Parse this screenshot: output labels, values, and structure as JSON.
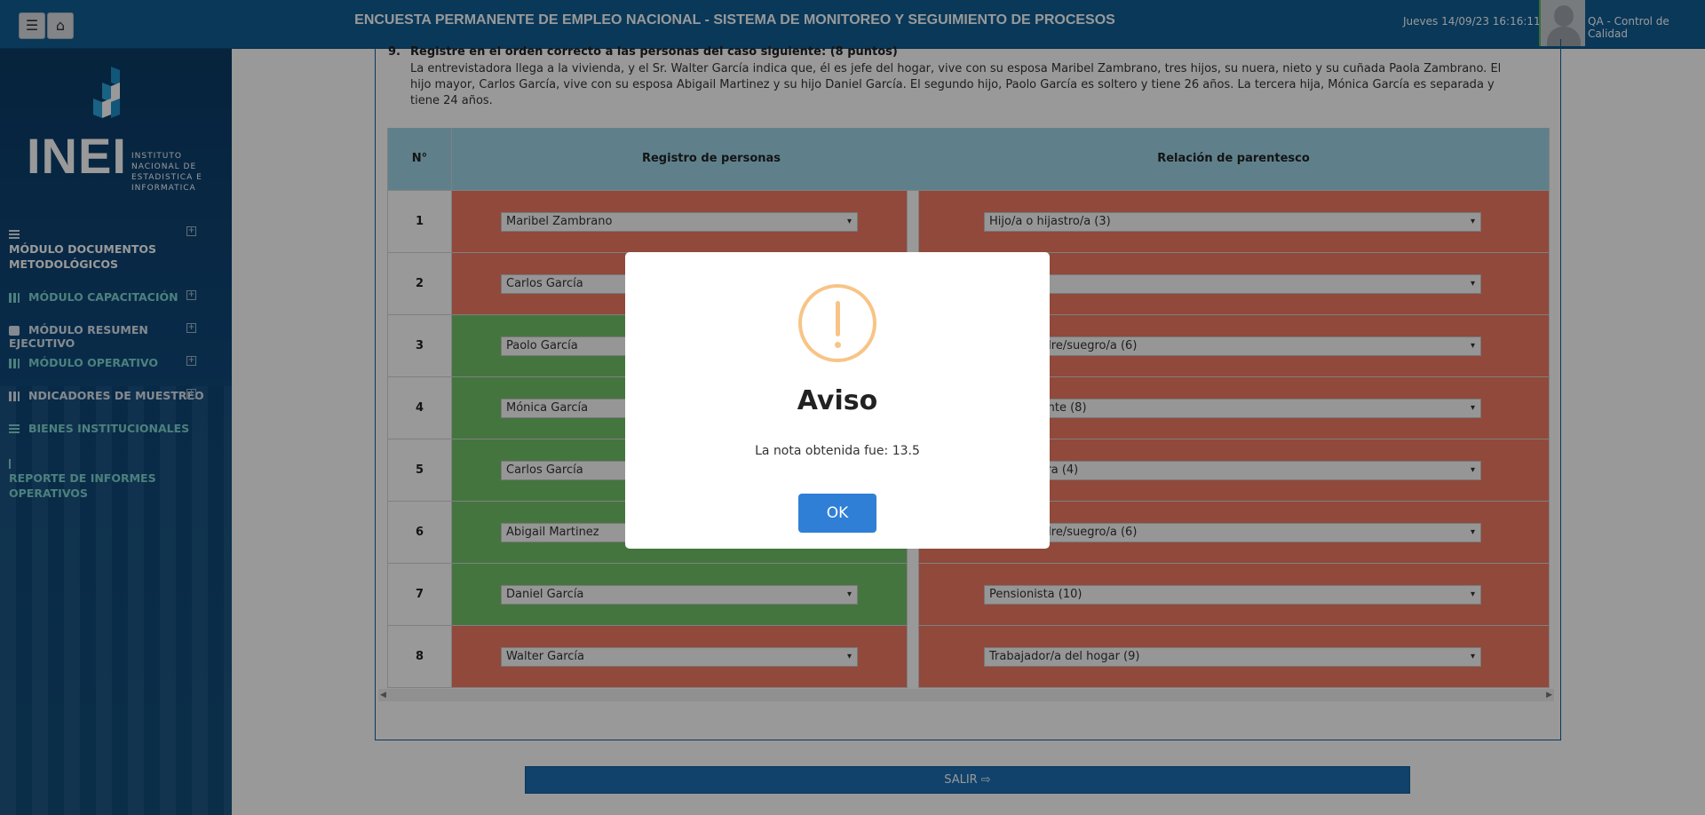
{
  "header": {
    "title": "ENCUESTA PERMANENTE DE EMPLEO NACIONAL - SISTEMA DE MONITOREO Y SEGUIMIENTO DE PROCESOS",
    "datetime": "Jueves 14/09/23 16:16:11",
    "user": "QA - Control de Calidad",
    "menu_icon": "hamburger-icon",
    "home_icon": "home-icon"
  },
  "logo": {
    "name": "INEI",
    "subtitle_lines": [
      "INSTITUTO",
      "NACIONAL DE",
      "ESTADISTICA E",
      "INFORMATICA"
    ]
  },
  "sidebar": {
    "items": [
      {
        "label": "MÓDULO DOCUMENTOS METODOLÓGICOS",
        "icon": "database-icon",
        "color": "#ffffff"
      },
      {
        "label": "MÓDULO CAPACITACIÓN",
        "icon": "bar-chart-icon",
        "color": "#7fd6d0"
      },
      {
        "label": "MÓDULO RESUMEN EJECUTIVO",
        "icon": "briefcase-icon",
        "color": "#dce6ef"
      },
      {
        "label": "MÓDULO OPERATIVO",
        "icon": "bar-chart-icon",
        "color": "#7fd6d0"
      },
      {
        "label": "NDICADORES DE MUESTREO",
        "icon": "bar-chart-icon",
        "color": "#dce6ef"
      },
      {
        "label": "BIENES INSTITUCIONALES",
        "icon": "table-icon",
        "color": "#7fd6d0"
      },
      {
        "label": "REPORTE DE INFORMES OPERATIVOS",
        "icon": "flag-icon",
        "color": "#7fd6d0"
      }
    ]
  },
  "question": {
    "number": "9.",
    "heading": "Registre en el orden correcto a las personas del caso siguiente: (8 puntos)",
    "text": "La entrevistadora llega a la vivienda, y el Sr. Walter García indica que, él es jefe del hogar, vive con su esposa Maribel Zambrano, tres hijos, su nuera, nieto y su cuñada Paola Zambrano. El hijo mayor, Carlos García, vive con su esposa Abigail Martinez y su hijo Daniel García. El segundo hijo, Paolo García es soltero y tiene 26 años. La tercera hija, Mónica García es separada y tiene 24 años."
  },
  "table": {
    "headers": [
      "N°",
      "Registro de personas",
      "Relación de parentesco"
    ],
    "rows": [
      {
        "n": "1",
        "person": "Maribel Zambrano",
        "relation": "Hijo/a o hijastro/a (3)",
        "person_status": "red",
        "relation_status": "red"
      },
      {
        "n": "2",
        "person": "Carlos García",
        "relation": "",
        "person_status": "red",
        "relation_status": "red"
      },
      {
        "n": "3",
        "person": "Paolo García",
        "relation": "Padre/madre/suegro/a (6)",
        "person_status": "green",
        "relation_status": "red"
      },
      {
        "n": "4",
        "person": "Mónica García",
        "relation": "Otro pariente (8)",
        "person_status": "green",
        "relation_status": "red"
      },
      {
        "n": "5",
        "person": "Carlos García",
        "relation": "Yerno/nuera (4)",
        "person_status": "green",
        "relation_status": "red"
      },
      {
        "n": "6",
        "person": "Abigail Martinez",
        "relation": "Padre/madre/suegro/a (6)",
        "person_status": "green",
        "relation_status": "red"
      },
      {
        "n": "7",
        "person": "Daniel García",
        "relation": "Pensionista (10)",
        "person_status": "green",
        "relation_status": "red"
      },
      {
        "n": "8",
        "person": "Walter García",
        "relation": "Trabajador/a del hogar (9)",
        "person_status": "red",
        "relation_status": "red"
      }
    ]
  },
  "salir": {
    "label": "SALIR",
    "icon": "sign-out-icon"
  },
  "modal": {
    "icon": "warning-icon",
    "title": "Aviso",
    "message": "La nota obtenida fue: 13.5",
    "ok_label": "OK"
  },
  "colors": {
    "header_bg": "#0f5e95",
    "table_header": "#9ed5e8",
    "incorrect": "#f07a63",
    "correct": "#72c46a",
    "ok_button": "#2f7fd6"
  }
}
